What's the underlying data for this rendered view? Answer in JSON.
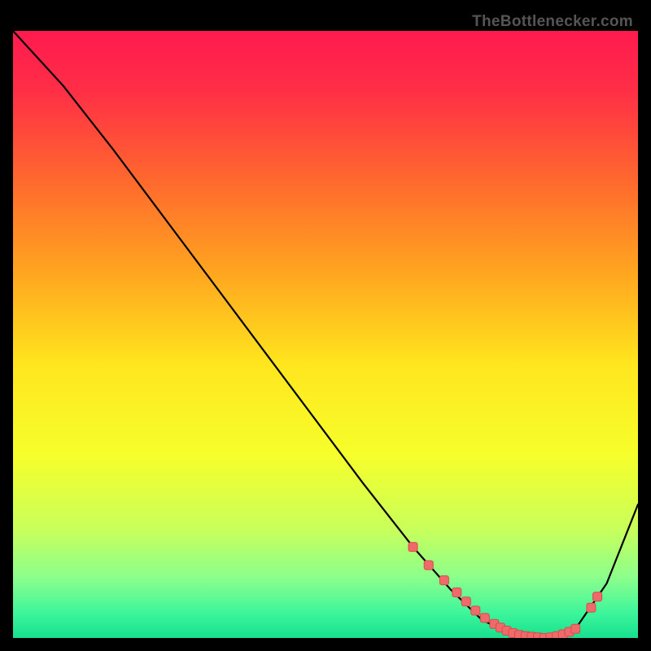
{
  "watermark": "TheBottlenecker.com",
  "chart_data": {
    "type": "line",
    "title": "",
    "xlabel": "",
    "ylabel": "",
    "xlim": [
      0,
      100
    ],
    "ylim": [
      0,
      100
    ],
    "background_gradient_stops": [
      {
        "offset": 0.0,
        "color": "#ff1a4f"
      },
      {
        "offset": 0.1,
        "color": "#ff2f46"
      },
      {
        "offset": 0.25,
        "color": "#ff6a2d"
      },
      {
        "offset": 0.4,
        "color": "#ffa61f"
      },
      {
        "offset": 0.55,
        "color": "#ffe61e"
      },
      {
        "offset": 0.7,
        "color": "#f6ff2b"
      },
      {
        "offset": 0.82,
        "color": "#c9ff5a"
      },
      {
        "offset": 0.9,
        "color": "#8cff8c"
      },
      {
        "offset": 0.96,
        "color": "#3cf59b"
      },
      {
        "offset": 1.0,
        "color": "#17e08e"
      }
    ],
    "series": [
      {
        "name": "bottleneck-curve",
        "type": "line",
        "x": [
          0.0,
          8.0,
          16.0,
          24.0,
          32.0,
          40.0,
          48.0,
          56.0,
          64.0,
          70.0,
          75.0,
          80.0,
          85.0,
          90.0,
          95.0,
          100.0
        ],
        "y": [
          100.0,
          91.0,
          80.5,
          69.5,
          58.5,
          47.5,
          36.5,
          25.5,
          15.0,
          8.0,
          3.0,
          0.5,
          0.0,
          1.5,
          9.0,
          22.0
        ]
      },
      {
        "name": "optimal-band-markers",
        "type": "scatter",
        "x": [
          64.0,
          66.5,
          69.0,
          71.0,
          72.5,
          74.0,
          75.5,
          77.0,
          78.0,
          79.0,
          80.0,
          81.0,
          82.0,
          83.0,
          84.0,
          85.0,
          86.0,
          87.0,
          88.0,
          89.0,
          90.0,
          92.5,
          93.5
        ],
        "y": [
          15.0,
          12.0,
          9.5,
          7.5,
          6.0,
          4.5,
          3.3,
          2.3,
          1.7,
          1.2,
          0.8,
          0.5,
          0.3,
          0.2,
          0.1,
          0.0,
          0.1,
          0.3,
          0.6,
          1.0,
          1.5,
          5.0,
          6.8
        ]
      }
    ]
  }
}
